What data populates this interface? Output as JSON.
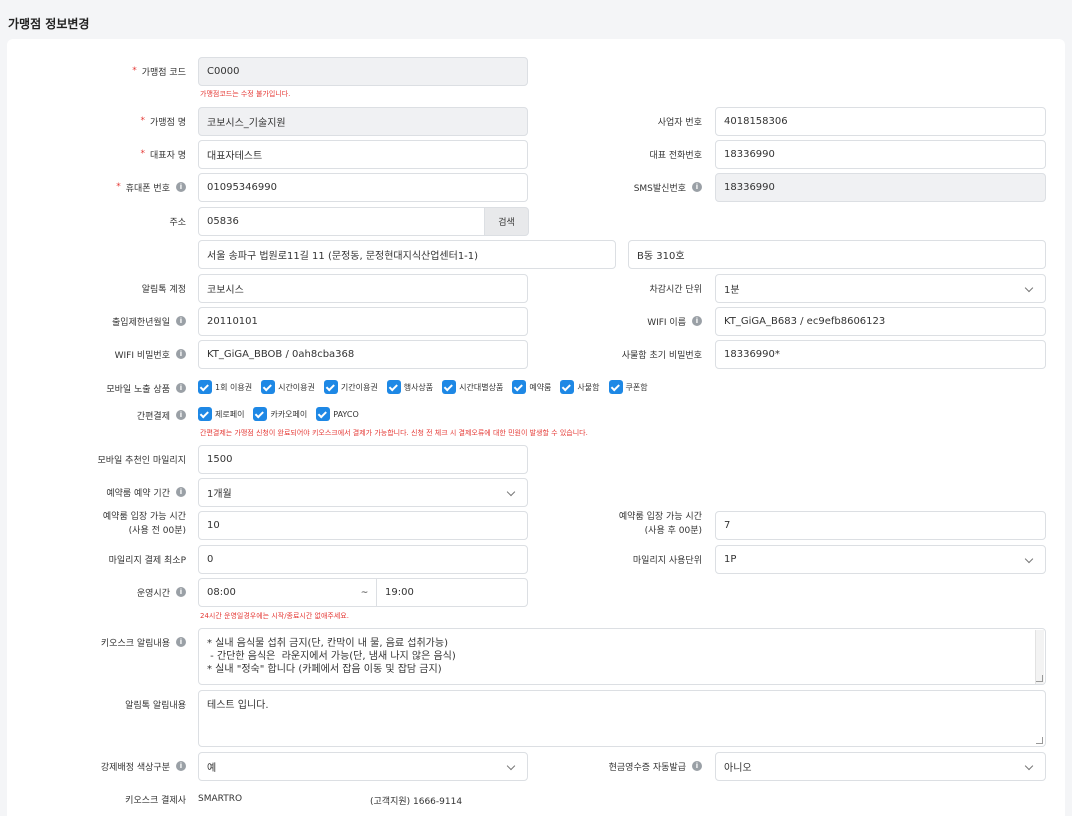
{
  "page_title": "가맹점 정보변경",
  "labels": {
    "franchise_code": "가맹점 코드",
    "franchise_name": "가맹점 명",
    "biz_number": "사업자 번호",
    "ceo_name": "대표자 명",
    "rep_phone": "대표 전화번호",
    "mobile": "휴대폰 번호",
    "sms_sender": "SMS발신번호",
    "address": "주소",
    "alimtalk_account": "알림톡 계정",
    "deduct_unit": "차감시간 단위",
    "entry_birth": "출입제한년월일",
    "wifi_name": "WIFI 이름",
    "wifi_pw": "WIFI 비밀번호",
    "locker_pw": "사물함 초기 비밀번호",
    "mobile_products": "모바일 노출 상품",
    "easy_pay": "간편결제",
    "referrer_mileage": "모바일 추천인 마일리지",
    "reserve_period": "예약룸 예약 기간",
    "entry_before_1": "예약룸 입장 가능 시간",
    "entry_before_2": "(사용 전 00분)",
    "entry_after_1": "예약룸 입장 가능 시간",
    "entry_after_2": "(사용 후 00분)",
    "mileage_min": "마일리지 결제 최소P",
    "mileage_unit": "마일리지 사용단위",
    "hours": "운영시간",
    "kiosk_notice": "키오스크 알림내용",
    "alimtalk_notice": "알림톡 알림내용",
    "forced_color": "강제배정 색상구분",
    "cash_receipt": "현금영수증 자동발급",
    "kiosk_pg": "키오스크 결제사"
  },
  "values": {
    "franchise_code": "C0000",
    "franchise_name": "코보시스_기술지원",
    "biz_number": "4018158306",
    "ceo_name": "대표자테스트",
    "rep_phone": "18336990",
    "mobile": "01095346990",
    "sms_sender": "18336990",
    "zipcode": "05836",
    "address1": "서울 송파구 법원로11길 11 (문정동, 문정현대지식산업센터1-1)",
    "address2": "B동 310호",
    "alimtalk_account": "코보시스",
    "deduct_unit": "1분",
    "entry_birth": "20110101",
    "wifi_name": "KT_GiGA_B683 / ec9efb8606123",
    "wifi_pw": "KT_GiGA_BBOB / 0ah8cba368",
    "locker_pw": "18336990*",
    "referrer_mileage": "1500",
    "reserve_period": "1개월",
    "entry_before": "10",
    "entry_after": "7",
    "mileage_min": "0",
    "mileage_unit": "1P",
    "hours_start": "08:00",
    "hours_tilde": "~",
    "hours_end": "19:00",
    "kiosk_notice_lines": [
      "* 실내 음식물 섭취 금지(단, 칸막이 내 물, 음료 섭취가능)",
      " - 간단한 음식은  라운지에서 가능(단, 냄새 나지 않은 음식)",
      "",
      "* 실내 \"정숙\" 합니다 (카페에서 잡음 이동 및 잡담 금지)"
    ],
    "alimtalk_notice": "테스트 입니다.",
    "forced_color": "예",
    "cash_receipt": "아니오",
    "kiosk_pg": "SMARTRO",
    "kiosk_pg_contact": "(고객지원) 1666-9114"
  },
  "buttons": {
    "search": "검색"
  },
  "messages": {
    "code_locked": "가맹점코드는 수정 불가입니다.",
    "easy_pay_warn": "간편결제는 가맹점 신청이 완료되어야 키오스크에서 결제가 가능합니다. 신청 전 체크 시 결제오류에 대한 민원이 발생할 수 있습니다.",
    "hours_warn": "24시간 운영일경우에는 시작/종료시간 없애주세요."
  },
  "mobile_products": [
    "1회 이용권",
    "시간이용권",
    "기간이용권",
    "행사상품",
    "시간대별상품",
    "예약룸",
    "사물함",
    "쿠폰함"
  ],
  "easy_pay_options": [
    "제로페이",
    "카카오페이",
    "PAYCO"
  ],
  "colors": {
    "checkbox": "#1e88e5",
    "required": "#e53935",
    "error": "#e53935"
  }
}
